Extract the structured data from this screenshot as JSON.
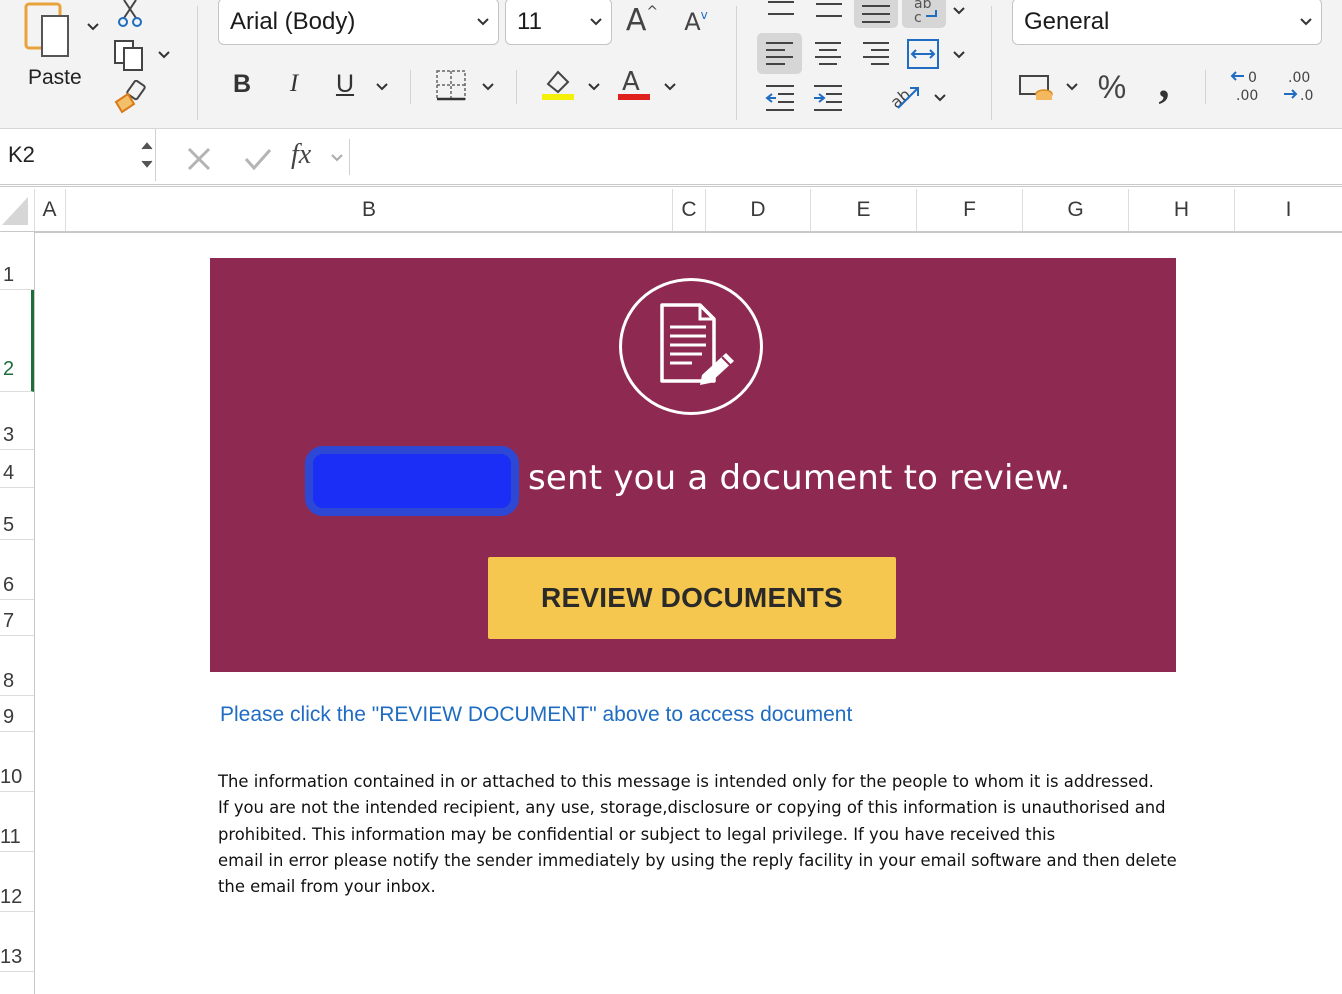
{
  "ribbon": {
    "clipboard": {
      "paste_label": "Paste"
    },
    "font": {
      "name": "Arial (Body)",
      "size": "11",
      "bold": "B",
      "italic": "I",
      "underline": "U"
    },
    "number": {
      "format": "General",
      "percent": "%",
      "comma": ","
    },
    "colors": {
      "highlight": "#f5f00a",
      "font_color": "#e0201c"
    }
  },
  "formula_bar": {
    "cell_ref": "K2",
    "fx_label": "fx",
    "value": ""
  },
  "sheet": {
    "columns": [
      "A",
      "B",
      "C",
      "D",
      "E",
      "F",
      "G",
      "H",
      "I"
    ],
    "rows": [
      "1",
      "2",
      "3",
      "4",
      "5",
      "6",
      "7",
      "8",
      "9",
      "10",
      "11",
      "12",
      "13"
    ],
    "active_row": "2"
  },
  "content": {
    "banner_color": "#8e2a52",
    "sent_text": "sent you a document to review.",
    "button_label": "REVIEW DOCUMENTS",
    "button_color": "#f5c74e",
    "instruction": "Please click the \"REVIEW DOCUMENT\" above to access document",
    "disclaimer_lines": [
      "The information contained in or attached to this message is intended only for the people to whom it is addressed.",
      "If you are not the intended recipient, any use, storage,disclosure or copying of this information is unauthorised and",
      "prohibited. This information may be confidential or subject to legal privilege. If you have received this",
      "email in error please notify the sender immediately by using the reply facility in your email software and then delete",
      "the email from your inbox."
    ]
  }
}
